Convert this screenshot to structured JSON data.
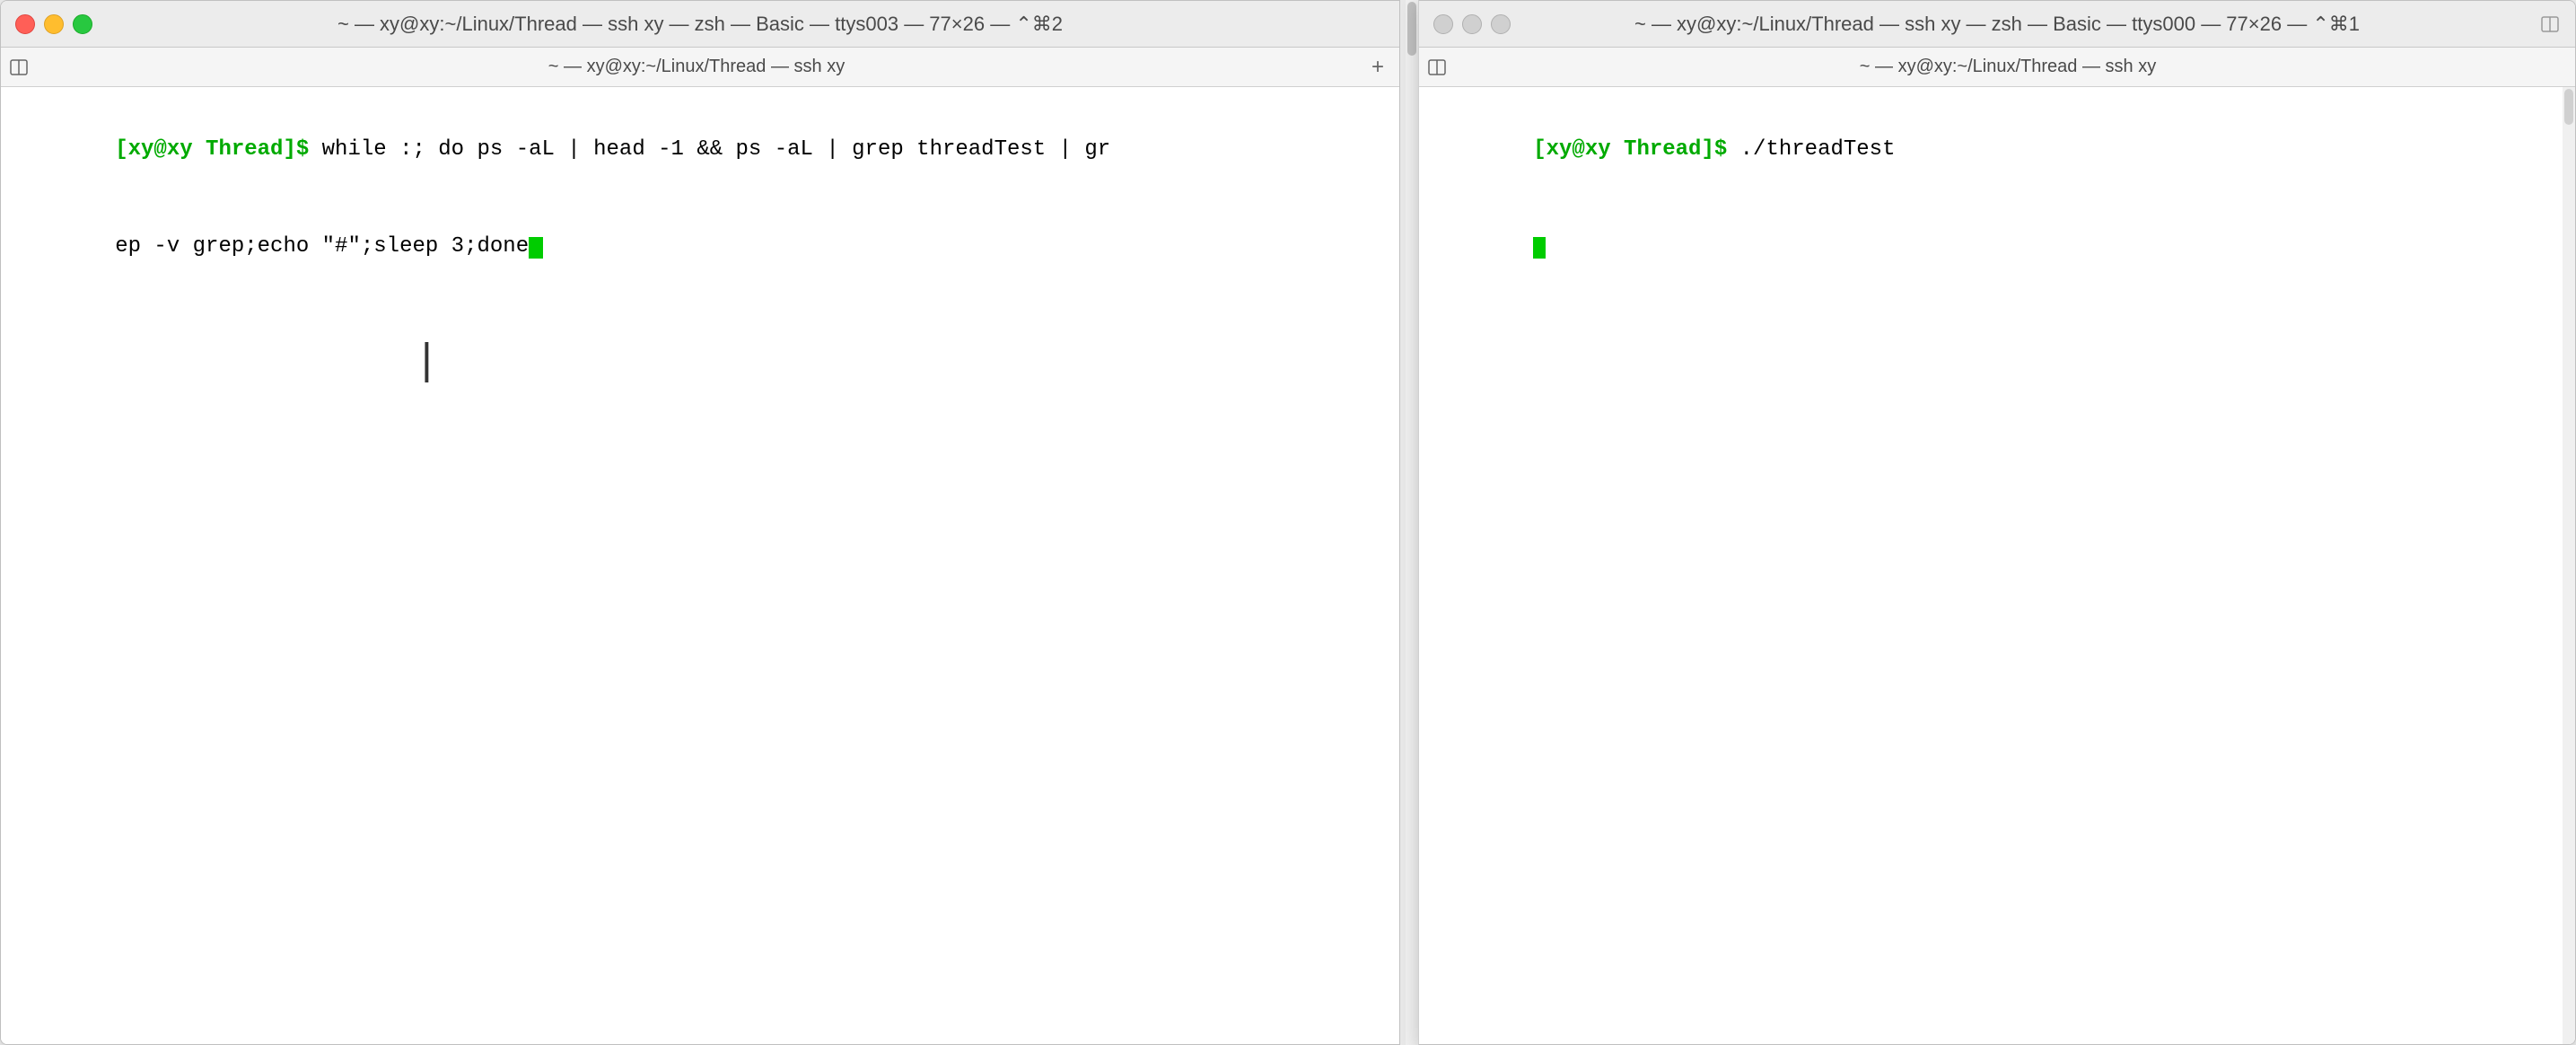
{
  "left_window": {
    "title_bar": {
      "title": "~ — xy@xy:~/Linux/Thread — ssh xy — zsh — Basic — ttys003 — 77×26 — ⌃⌘2"
    },
    "tab_bar": {
      "label": "~ — xy@xy:~/Linux/Thread — ssh xy",
      "add_button": "+"
    },
    "terminal": {
      "line1_prompt": "[xy@xy Thread]$ ",
      "line1_content": "while :; do ps -aL | head -1 && ps -aL | grep threadTest | gr",
      "line2_content": "ep -v grep;echo \"#\";sleep 3;done"
    }
  },
  "right_window": {
    "title_bar": {
      "title": "~ — xy@xy:~/Linux/Thread — ssh xy — zsh — Basic — ttys000 — 77×26 — ⌃⌘1"
    },
    "tab_bar": {
      "label": "~ — xy@xy:~/Linux/Thread — ssh xy"
    },
    "terminal": {
      "line1_prompt": "[xy@xy Thread]$ ",
      "line1_content": "./threadTest"
    }
  },
  "icons": {
    "close": "●",
    "minimize": "●",
    "maximize": "●",
    "split": "⊞"
  }
}
